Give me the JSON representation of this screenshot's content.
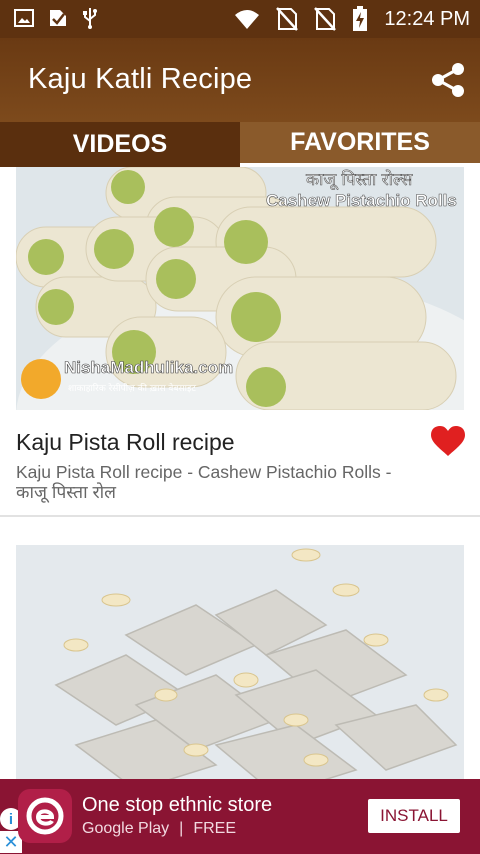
{
  "status_bar": {
    "time": "12:24 PM",
    "icons": [
      "image-icon",
      "download-check-icon",
      "usb-icon",
      "wifi-icon",
      "no-sim-icon",
      "no-sim-icon",
      "battery-charging-icon"
    ]
  },
  "app_bar": {
    "title": "Kaju Katli Recipe",
    "share_icon": "share-icon"
  },
  "tabs": [
    {
      "label": "VIDEOS",
      "selected": false
    },
    {
      "label": "FAVORITES",
      "selected": true
    }
  ],
  "items": [
    {
      "title": "Kaju Pista Roll recipe",
      "description": "Kaju Pista Roll recipe - Cashew Pistachio Rolls - काजू पिस्ता रोल",
      "thumbnail_overlay_hindi": "काजू पिस्ता रोल्स",
      "thumbnail_overlay_english": "Cashew Pistachio Rolls",
      "thumbnail_watermark": "NishaMadhulika.com",
      "thumbnail_watermark_sub": "शाकाहारिक रेसीपीज़ की ख़ास वेबसाइट",
      "favorite": true
    },
    {
      "thumbnail_subject": "kaju katli",
      "favorite": false
    }
  ],
  "ad": {
    "title": "One stop ethnic store",
    "store": "Google Play",
    "price": "FREE",
    "install_label": "INSTALL",
    "info_glyph": "i",
    "close_glyph": "✕",
    "accent": "#8a1433"
  },
  "colors": {
    "status_bar": "#5e3210",
    "app_bar": "#7d4a1c",
    "tab_selected_indicator": "#ffffff",
    "heart": "#e02020"
  }
}
